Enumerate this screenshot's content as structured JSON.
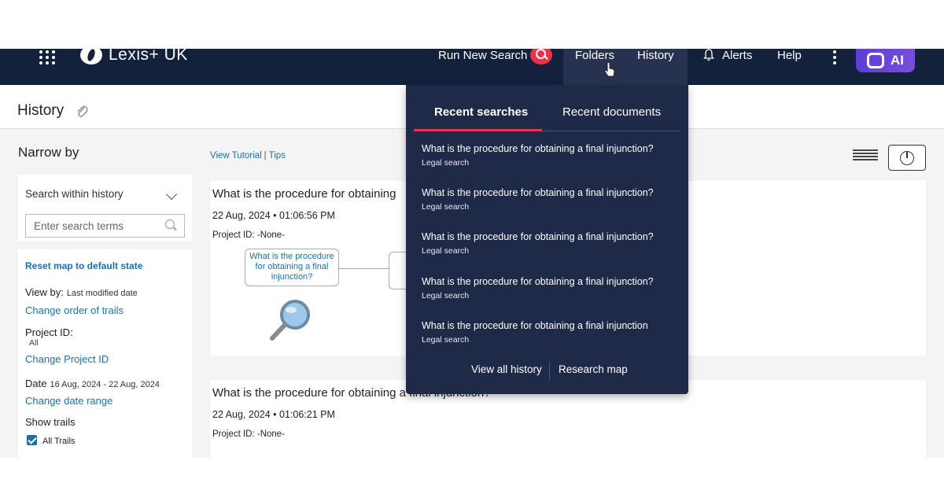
{
  "nav": {
    "brand": "Lexis+ UK",
    "run_new_search": "Run New Search",
    "folders": "Folders",
    "history": "History",
    "alerts": "Alerts",
    "help": "Help",
    "ai": "AI",
    "accent_color": "#e8344a",
    "nav_bg": "#14213d"
  },
  "page": {
    "title": "History"
  },
  "sidebar": {
    "heading": "Narrow by",
    "search_within_label": "Search within history",
    "search_placeholder": "Enter search terms",
    "reset_link": "Reset map to default state",
    "view_by_label": "View by:",
    "view_by_value": "Last modified date",
    "change_order": "Change order of trails",
    "project_id_label": "Project ID:",
    "project_id_value": "All",
    "change_project": "Change Project ID",
    "date_label": "Date",
    "date_value": "16 Aug, 2024 - 22 Aug, 2024",
    "change_date": "Change date range",
    "show_trails_label": "Show trails",
    "all_trails_label": "All Trails"
  },
  "main": {
    "view_tutorial": "View Tutorial",
    "tips": "Tips",
    "cards": [
      {
        "title": "What is the procedure for obtaining",
        "date": "22 Aug, 2024 • 01:06:56 PM",
        "project": "Project ID: -None-",
        "node_text": "What is the procedure for obtaining a final injunction?"
      },
      {
        "title": "What is the procedure for obtaining a final injunction?",
        "date": "22 Aug, 2024 • 01:06:21 PM",
        "project": "Project ID: -None-"
      }
    ]
  },
  "dropdown": {
    "tab_recent_searches": "Recent searches",
    "tab_recent_documents": "Recent documents",
    "results": [
      {
        "title": "What is the procedure for obtaining a final injunction?",
        "type": "Legal search"
      },
      {
        "title": "What is the procedure for obtaining a final injunction?",
        "type": "Legal search"
      },
      {
        "title": "What is the procedure for obtaining a final injunction?",
        "type": "Legal search"
      },
      {
        "title": "What is the procedure for obtaining a final injunction?",
        "type": "Legal search"
      },
      {
        "title": "What is the procedure for obtaining a final injunction",
        "type": "Legal search"
      }
    ],
    "view_all_history": "View all history",
    "research_map": "Research map"
  }
}
